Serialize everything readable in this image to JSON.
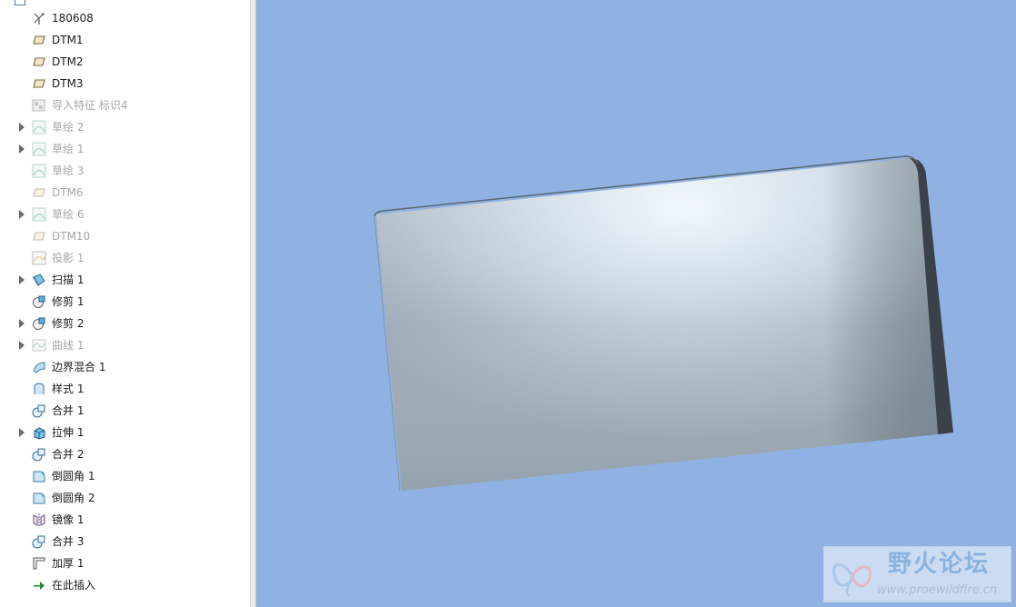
{
  "model_tree": {
    "items": [
      {
        "label": "180608",
        "icon": "coordinate-system-icon",
        "expandable": false,
        "suppressed": false
      },
      {
        "label": "DTM1",
        "icon": "datum-plane-icon",
        "expandable": false,
        "suppressed": false
      },
      {
        "label": "DTM2",
        "icon": "datum-plane-icon",
        "expandable": false,
        "suppressed": false
      },
      {
        "label": "DTM3",
        "icon": "datum-plane-icon",
        "expandable": false,
        "suppressed": false
      },
      {
        "label": "导入特征 标识4",
        "icon": "import-feature-icon",
        "expandable": false,
        "suppressed": true
      },
      {
        "label": "草绘 2",
        "icon": "sketch-icon",
        "expandable": true,
        "suppressed": true
      },
      {
        "label": "草绘 1",
        "icon": "sketch-icon",
        "expandable": true,
        "suppressed": true
      },
      {
        "label": "草绘 3",
        "icon": "sketch-icon",
        "expandable": false,
        "suppressed": true
      },
      {
        "label": "DTM6",
        "icon": "datum-plane-icon",
        "expandable": false,
        "suppressed": true
      },
      {
        "label": "草绘 6",
        "icon": "sketch-icon",
        "expandable": true,
        "suppressed": true
      },
      {
        "label": "DTM10",
        "icon": "datum-plane-icon",
        "expandable": false,
        "suppressed": true
      },
      {
        "label": "投影 1",
        "icon": "projection-icon",
        "expandable": false,
        "suppressed": true
      },
      {
        "label": "扫描 1",
        "icon": "sweep-icon",
        "expandable": true,
        "suppressed": false
      },
      {
        "label": "修剪 1",
        "icon": "trim-icon",
        "expandable": false,
        "suppressed": false
      },
      {
        "label": "修剪 2",
        "icon": "trim-icon",
        "expandable": true,
        "suppressed": false
      },
      {
        "label": "曲线 1",
        "icon": "curve-icon",
        "expandable": true,
        "suppressed": true
      },
      {
        "label": "边界混合 1",
        "icon": "boundary-blend-icon",
        "expandable": false,
        "suppressed": false
      },
      {
        "label": "样式 1",
        "icon": "style-icon",
        "expandable": false,
        "suppressed": false
      },
      {
        "label": "合并 1",
        "icon": "merge-icon",
        "expandable": false,
        "suppressed": false
      },
      {
        "label": "拉伸 1",
        "icon": "extrude-icon",
        "expandable": true,
        "suppressed": false
      },
      {
        "label": "合并 2",
        "icon": "merge-icon",
        "expandable": false,
        "suppressed": false
      },
      {
        "label": "倒圆角 1",
        "icon": "round-icon",
        "expandable": false,
        "suppressed": false
      },
      {
        "label": "倒圆角 2",
        "icon": "round-icon",
        "expandable": false,
        "suppressed": false
      },
      {
        "label": "镜像 1",
        "icon": "mirror-icon",
        "expandable": false,
        "suppressed": false
      },
      {
        "label": "合并 3",
        "icon": "merge-icon",
        "expandable": false,
        "suppressed": false
      },
      {
        "label": "加厚 1",
        "icon": "thicken-icon",
        "expandable": false,
        "suppressed": false
      },
      {
        "label": "在此插入",
        "icon": "insert-here-arrow-icon",
        "expandable": false,
        "suppressed": false
      }
    ]
  },
  "viewport": {
    "background_color": "#8fb2e2"
  },
  "watermark": {
    "title": "野火论坛",
    "url": "www.proewildfire.cn"
  }
}
